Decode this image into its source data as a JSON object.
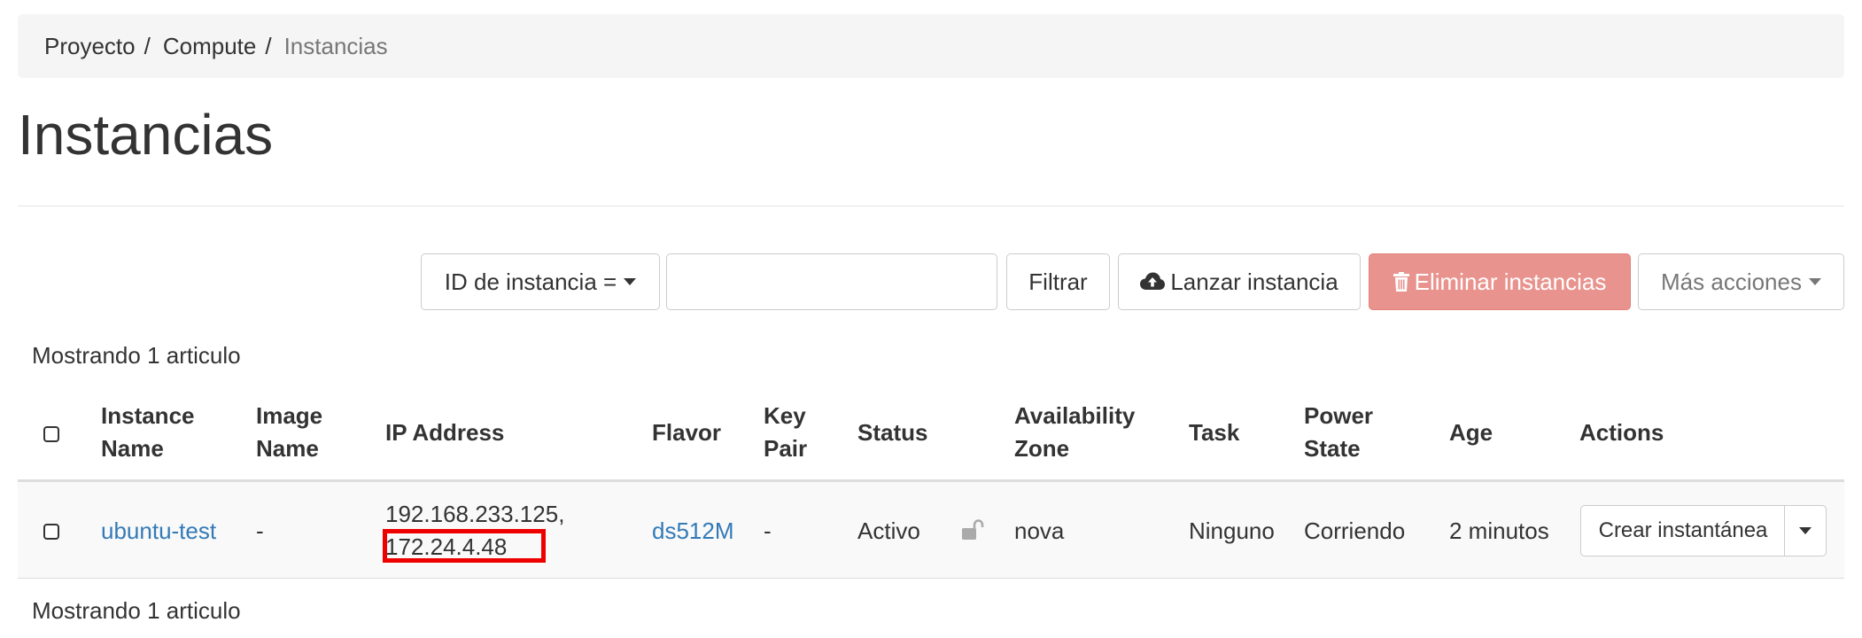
{
  "breadcrumb": {
    "items": [
      "Proyecto",
      "Compute",
      "Instancias"
    ],
    "separator": "/"
  },
  "page": {
    "title": "Instancias"
  },
  "toolbar": {
    "filter_field": "ID de instancia =",
    "filter_input_value": "",
    "filter_button": "Filtrar",
    "launch_button": "Lanzar instancia",
    "delete_button": "Eliminar instancias",
    "more_button": "Más acciones"
  },
  "summary": {
    "top": "Mostrando 1 articulo",
    "bottom": "Mostrando 1 articulo"
  },
  "table": {
    "headers": {
      "instance_name": [
        "Instance",
        "Name"
      ],
      "image_name": [
        "Image",
        "Name"
      ],
      "ip_address": "IP Address",
      "flavor": "Flavor",
      "key_pair": [
        "Key",
        "Pair"
      ],
      "status": "Status",
      "availability_zone": [
        "Availability",
        "Zone"
      ],
      "task": "Task",
      "power_state": [
        "Power",
        "State"
      ],
      "age": "Age",
      "actions": "Actions"
    },
    "rows": [
      {
        "instance_name": "ubuntu-test",
        "image_name": "-",
        "ip_addresses": [
          "192.168.233.125,",
          "172.24.4.48"
        ],
        "flavor": "ds512M",
        "key_pair": "-",
        "status": "Activo",
        "lock_icon": "unlock-icon",
        "availability_zone": "nova",
        "task": "Ninguno",
        "power_state": "Corriendo",
        "age": "2 minutos",
        "action_label": "Crear instantánea"
      }
    ]
  },
  "colors": {
    "link": "#337ab7",
    "danger_button": "#e9938e",
    "highlight": "#ee0000",
    "breadcrumb_bg": "#f5f5f5"
  }
}
